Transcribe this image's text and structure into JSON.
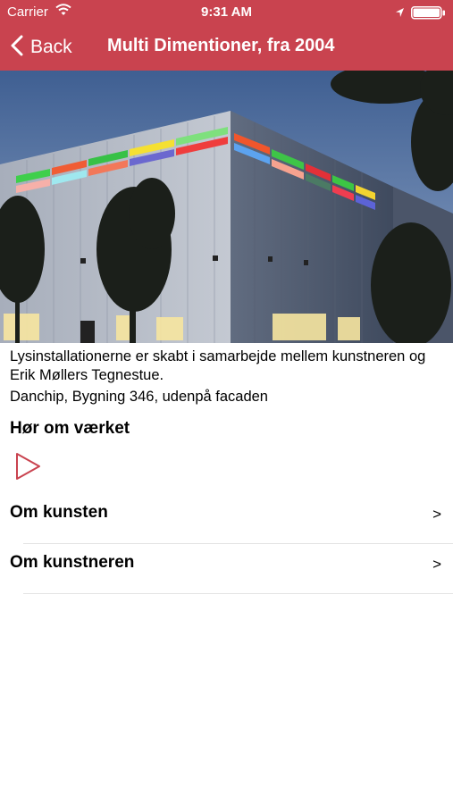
{
  "status_bar": {
    "carrier": "Carrier",
    "time": "9:31 AM",
    "icons": [
      "wifi-icon",
      "location-arrow-icon",
      "battery-icon"
    ]
  },
  "nav": {
    "back_label": "Back",
    "title": "Multi Dimentioner, fra 2004",
    "color": "#c9434f"
  },
  "artwork": {
    "description": "Lysinstallationerne er skabt i samarbejde mellem kunstneren og Erik Møllers Tegnestue.",
    "location": "Danchip, Bygning 346, udenpå facaden"
  },
  "audio": {
    "heading": "Hør om værket",
    "play_icon": "play-icon"
  },
  "menu": {
    "items": [
      {
        "label": "Om kunsten",
        "chevron": ">"
      },
      {
        "label": "Om kunstneren",
        "chevron": ">"
      }
    ]
  }
}
